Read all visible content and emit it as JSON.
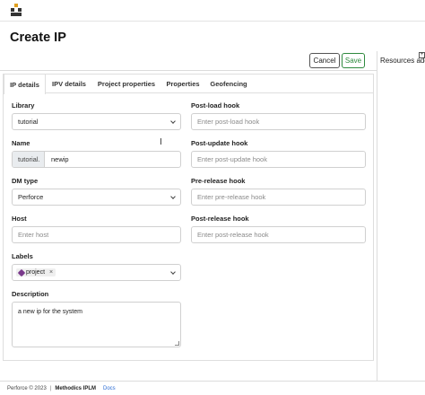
{
  "app": {
    "logo_icon": "methodics-logo-icon"
  },
  "page": {
    "title": "Create IP"
  },
  "actions": {
    "cancel_label": "Cancel",
    "save_label": "Save"
  },
  "side_panel": {
    "title": "Resources added"
  },
  "tabs": [
    {
      "label": "IP details",
      "active": true
    },
    {
      "label": "IPV details",
      "active": false
    },
    {
      "label": "Project properties",
      "active": false
    },
    {
      "label": "Properties",
      "active": false
    },
    {
      "label": "Geofencing",
      "active": false
    }
  ],
  "form": {
    "library": {
      "label": "Library",
      "value": "tutorial"
    },
    "name": {
      "label": "Name",
      "prefix": "tutorial.",
      "value": "newip"
    },
    "dm_type": {
      "label": "DM type",
      "value": "Perforce"
    },
    "host": {
      "label": "Host",
      "placeholder": "Enter host"
    },
    "labels": {
      "label": "Labels",
      "chips": [
        "project"
      ]
    },
    "description": {
      "label": "Description",
      "value": "a new ip for the system"
    },
    "post_load_hook": {
      "label": "Post-load hook",
      "placeholder": "Enter post-load hook"
    },
    "post_update_hook": {
      "label": "Post-update hook",
      "placeholder": "Enter post-update hook"
    },
    "pre_release_hook": {
      "label": "Pre-release hook",
      "placeholder": "Enter pre-release hook"
    },
    "post_release_hook": {
      "label": "Post-release hook",
      "placeholder": "Enter post-release hook"
    }
  },
  "footer": {
    "copyright": "Perforce © 2023",
    "separator": "|",
    "brand": "Methodics IPLM",
    "docs_label": "Docs"
  },
  "colors": {
    "save_accent": "#2e8a3e",
    "label_tag": "#7a3a8c",
    "docs_link": "#2b6cd4"
  }
}
